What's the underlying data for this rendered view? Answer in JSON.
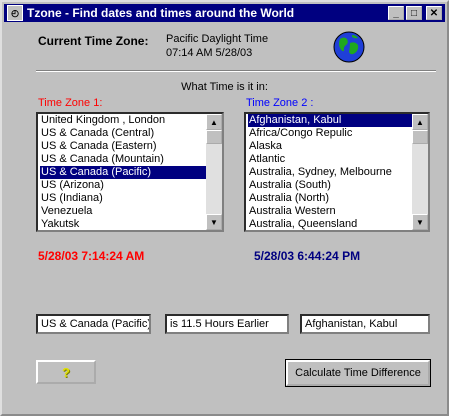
{
  "window": {
    "title": "Tzone - Find dates and times around the World",
    "icon_name": "clock-icon",
    "minimize_label": "_",
    "maximize_label": "□",
    "close_label": "✕"
  },
  "current": {
    "label": "Current Time Zone:",
    "zone_name": "Pacific Daylight Time",
    "zone_time": "07:14 AM  5/28/03",
    "globe_icon": "globe-icon"
  },
  "prompt": "What Time is it in:",
  "zone1": {
    "label": "Time Zone 1:",
    "label_color": "#ff0000",
    "items": [
      "United Kingdom , London",
      "US & Canada (Central)",
      "US & Canada (Eastern)",
      "US & Canada (Mountain)",
      "US & Canada (Pacific)",
      "US (Arizona)",
      "US (Indiana)",
      "Venezuela",
      "Yakutsk"
    ],
    "selected_index": 4,
    "time": "5/28/03 7:14:24 AM"
  },
  "zone2": {
    "label": "Time Zone 2 :",
    "label_color": "#0000ff",
    "items": [
      "Afghanistan, Kabul",
      "Africa/Congo Repulic",
      "Alaska",
      "Atlantic",
      "Australia, Sydney, Melbourne",
      "Australia  (South)",
      "Australia (North)",
      "Australia Western",
      "Australia, Queensland"
    ],
    "selected_index": 0,
    "time": "5/28/03 6:44:24 PM"
  },
  "result": {
    "zone1_value": "US & Canada (Pacific)",
    "difference": "is 11.5 Hours Earlier",
    "zone2_value": "Afghanistan, Kabul"
  },
  "buttons": {
    "help_icon": "?",
    "calculate_label": "Calculate Time Difference"
  },
  "colors": {
    "titlebar": "#000080",
    "selection": "#000080",
    "zone1_time": "#ff0000",
    "zone2_time": "#000080"
  }
}
